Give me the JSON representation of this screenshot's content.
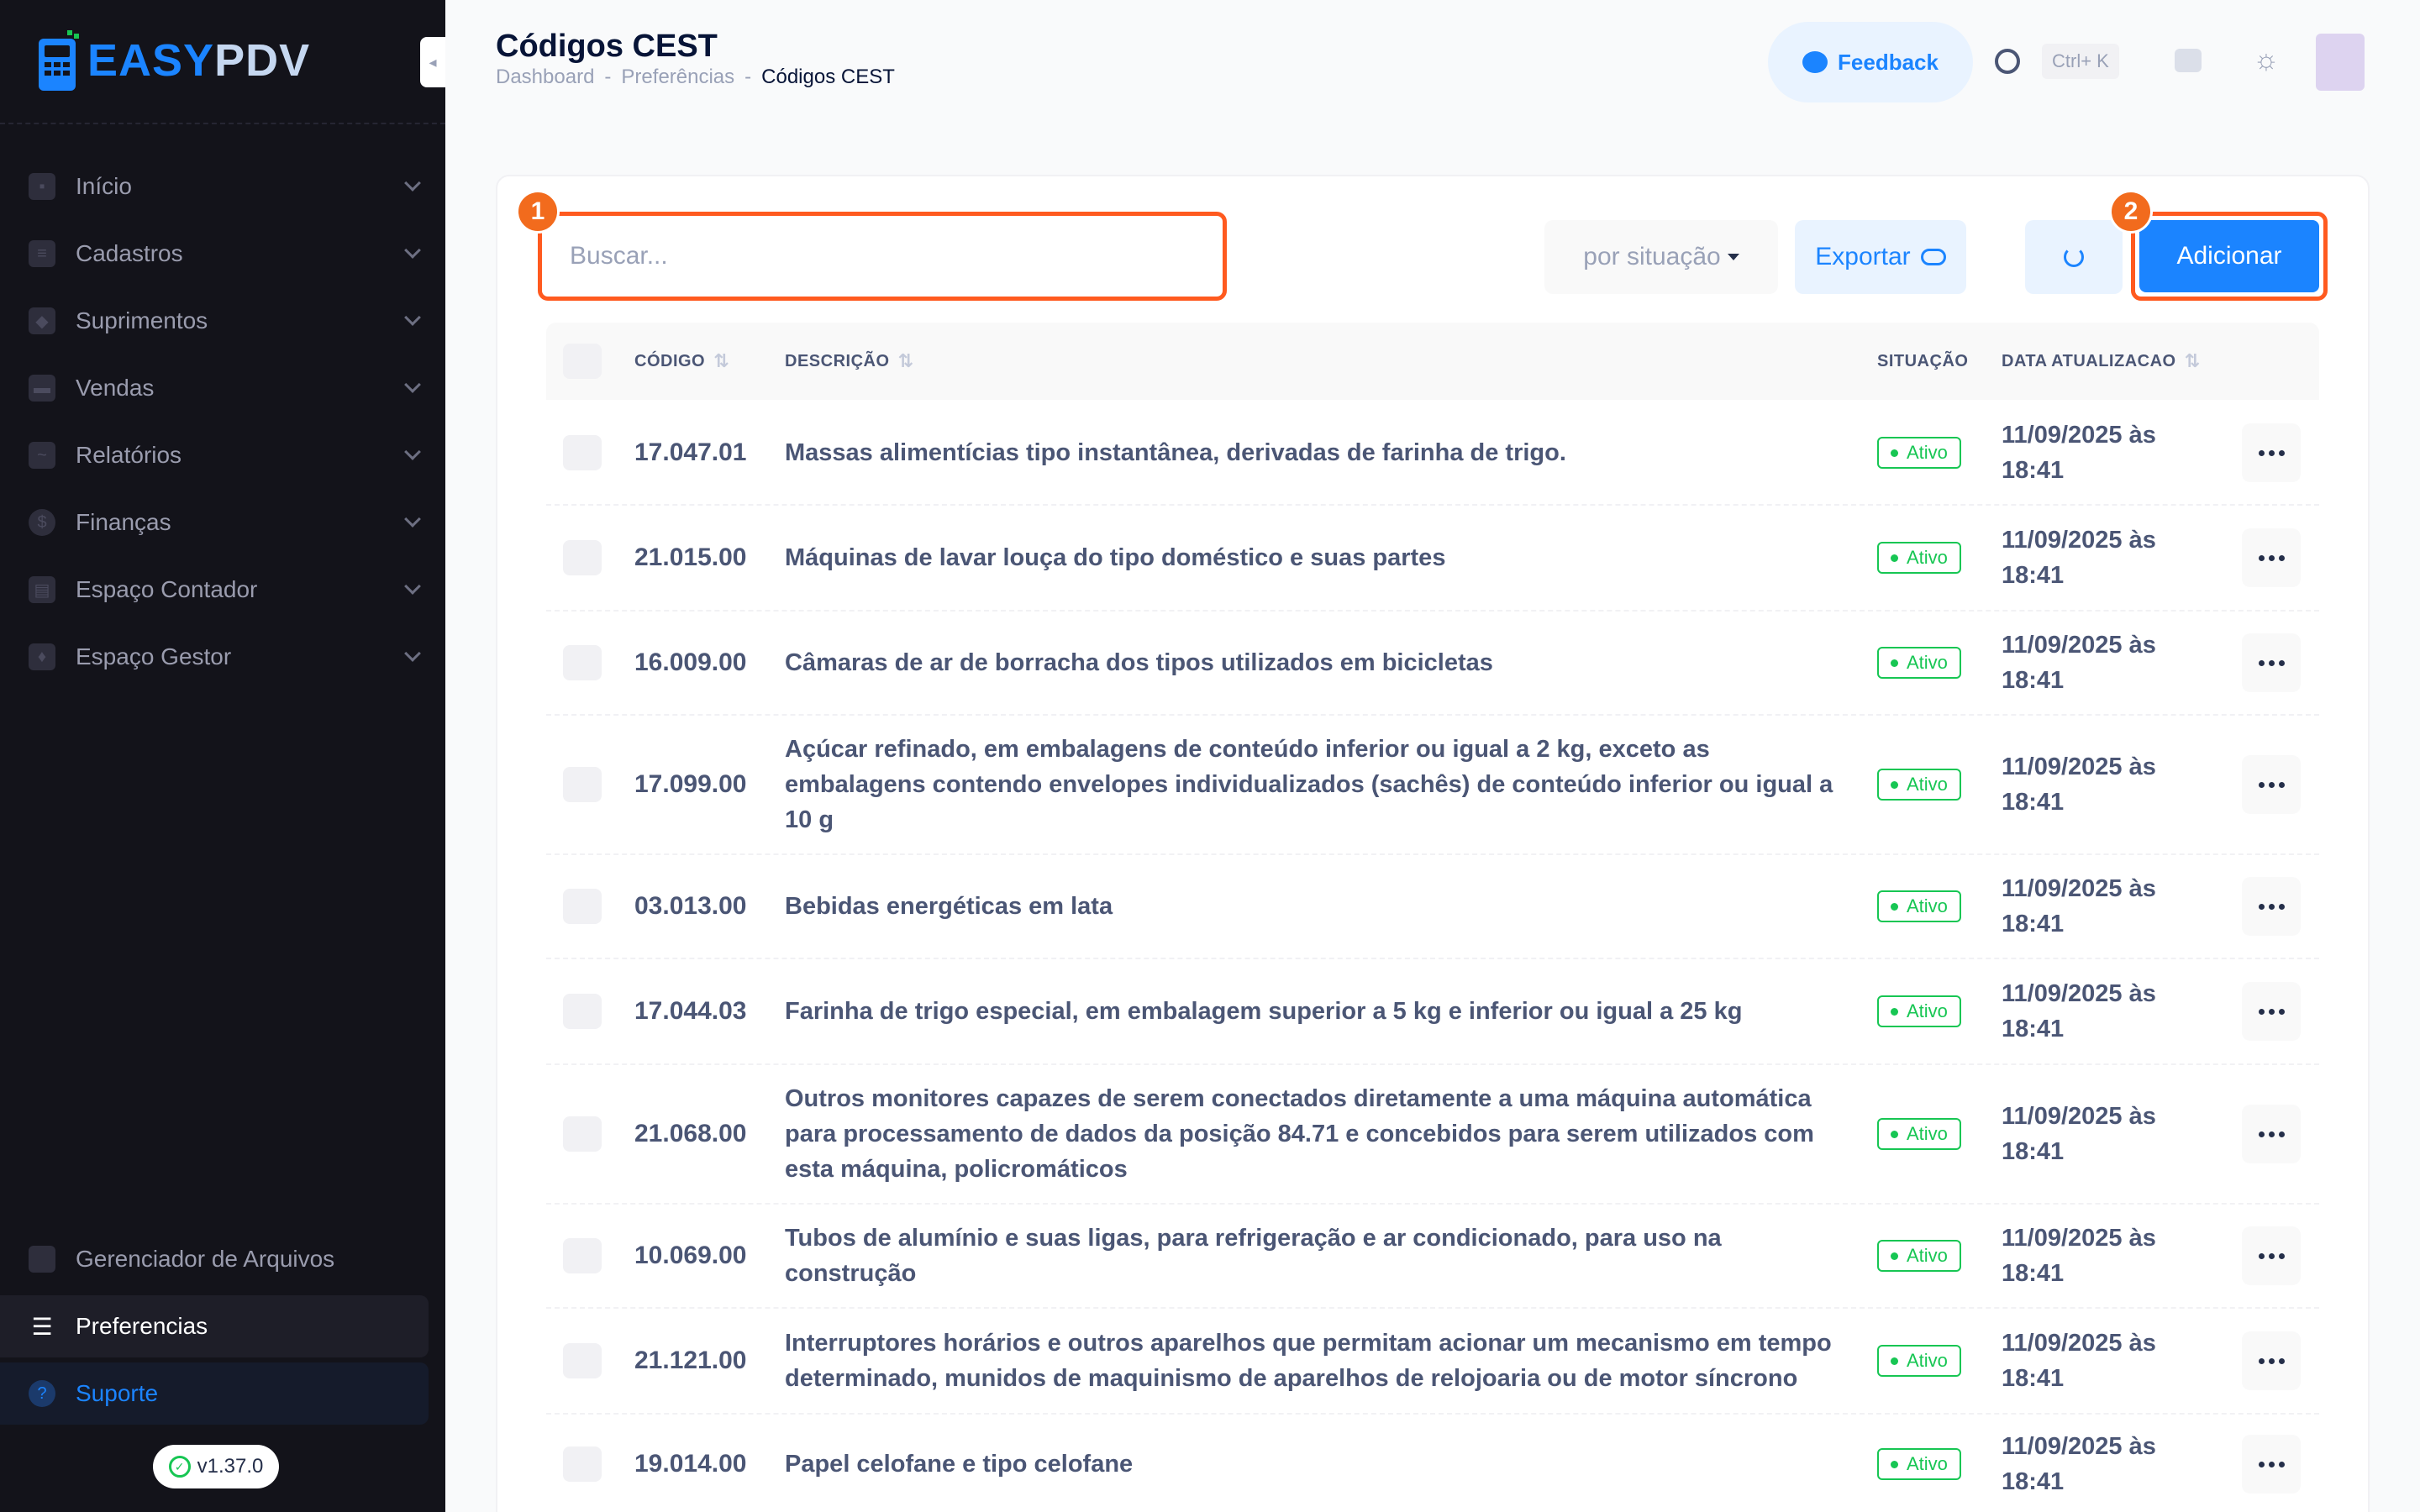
{
  "brand": {
    "name_part1": "EASY",
    "name_part2": "PDV"
  },
  "sidebar": {
    "items": [
      {
        "label": "Início",
        "icon": "home-icon"
      },
      {
        "label": "Cadastros",
        "icon": "id-card-icon"
      },
      {
        "label": "Suprimentos",
        "icon": "box-icon"
      },
      {
        "label": "Vendas",
        "icon": "register-icon"
      },
      {
        "label": "Relatórios",
        "icon": "chart-icon"
      },
      {
        "label": "Finanças",
        "icon": "dollar-icon"
      },
      {
        "label": "Espaço Contador",
        "icon": "calculator-icon"
      },
      {
        "label": "Espaço Gestor",
        "icon": "manager-icon"
      }
    ],
    "bottom": [
      {
        "label": "Gerenciador de Arquivos",
        "icon": "folder-icon"
      },
      {
        "label": "Preferencias",
        "icon": "sliders-icon"
      },
      {
        "label": "Suporte",
        "icon": "help-icon"
      }
    ],
    "version": "v1.37.0"
  },
  "header": {
    "title": "Códigos CEST",
    "breadcrumb": [
      "Dashboard",
      "-",
      "Preferências",
      "-",
      "Códigos CEST"
    ],
    "feedback_label": "Feedback",
    "shortcut": "Ctrl+ K"
  },
  "toolbar": {
    "search_placeholder": "Buscar...",
    "filter_label": "por situação",
    "export_label": "Exportar",
    "add_label": "Adicionar",
    "marker_1": "1",
    "marker_2": "2"
  },
  "table": {
    "columns": [
      "CÓDIGO",
      "DESCRIÇÃO",
      "SITUAÇÃO",
      "DATA ATUALIZACAO"
    ],
    "rows": [
      {
        "code": "17.047.01",
        "desc": "Massas alimentícias tipo instantânea, derivadas de farinha de trigo.",
        "status": "Ativo",
        "date": "11/09/2025 às 18:41"
      },
      {
        "code": "21.015.00",
        "desc": "Máquinas de lavar louça do tipo doméstico e suas partes",
        "status": "Ativo",
        "date": "11/09/2025 às 18:41"
      },
      {
        "code": "16.009.00",
        "desc": "Câmaras de ar de borracha dos tipos utilizados em bicicletas",
        "status": "Ativo",
        "date": "11/09/2025 às 18:41"
      },
      {
        "code": "17.099.00",
        "desc": "Açúcar refinado, em embalagens de conteúdo inferior ou igual a 2 kg, exceto as embalagens contendo envelopes individualizados (sachês) de conteúdo inferior ou igual a 10 g",
        "status": "Ativo",
        "date": "11/09/2025 às 18:41"
      },
      {
        "code": "03.013.00",
        "desc": "Bebidas energéticas em lata",
        "status": "Ativo",
        "date": "11/09/2025 às 18:41"
      },
      {
        "code": "17.044.03",
        "desc": "Farinha de trigo especial, em embalagem superior a 5 kg e inferior ou igual a 25 kg",
        "status": "Ativo",
        "date": "11/09/2025 às 18:41"
      },
      {
        "code": "21.068.00",
        "desc": "Outros monitores capazes de serem conectados diretamente a uma máquina automática para processamento de dados da posição 84.71 e concebidos para serem utilizados com esta máquina, policromáticos",
        "status": "Ativo",
        "date": "11/09/2025 às 18:41"
      },
      {
        "code": "10.069.00",
        "desc": "Tubos de alumínio e suas ligas, para refrigeração e ar condicionado, para uso na construção",
        "status": "Ativo",
        "date": "11/09/2025 às 18:41"
      },
      {
        "code": "21.121.00",
        "desc": "Interruptores horários e outros aparelhos que permitam acionar um mecanismo em tempo determinado, munidos de maquinismo de aparelhos de relojoaria ou de motor síncrono",
        "status": "Ativo",
        "date": "11/09/2025 às 18:41"
      },
      {
        "code": "19.014.00",
        "desc": "Papel celofane e tipo celofane",
        "status": "Ativo",
        "date": "11/09/2025 às 18:41"
      }
    ]
  },
  "colors": {
    "accent": "#1b84ff",
    "highlight": "#ff5a1f",
    "success": "#17c653",
    "sidebar_bg": "#13131a"
  }
}
